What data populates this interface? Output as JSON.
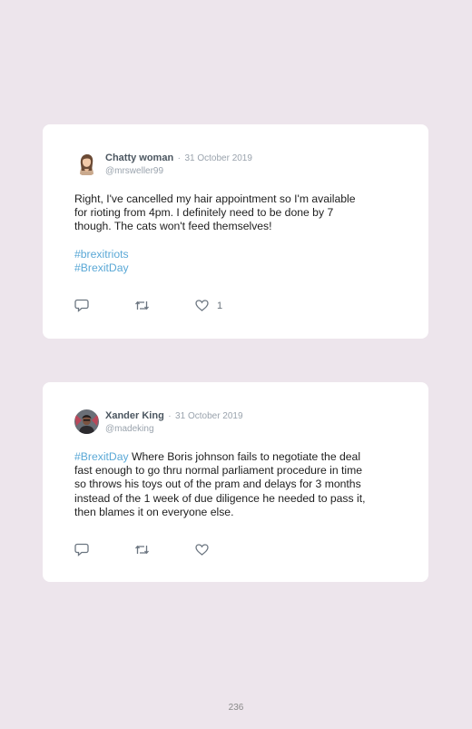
{
  "posts": [
    {
      "author": "Chatty woman",
      "separator": "·",
      "date": "31 October 2019",
      "handle": "@mrsweller99",
      "text_lines": [
        "Right, I've cancelled my hair appointment so I'm available",
        "for rioting from 4pm. I definitely need to be done by 7",
        "though. The cats won't feed themselves!"
      ],
      "hashtags": [
        "#brexitriots",
        "#BrexitDay"
      ],
      "likes": "1",
      "avatar_icon": "woman-avatar-icon"
    },
    {
      "author": "Xander King",
      "separator": "·",
      "date": "31 October 2019",
      "handle": "@madeking",
      "lead_hashtag": "#BrexitDay",
      "text_lead": " Where Boris johnson fails to negotiate the deal",
      "text_lines": [
        "fast enough to go thru normal parliament procedure in time",
        "so throws his toys out of the pram and delays for 3 months",
        "instead of the 1 week of due diligence he needed to pass it,",
        "then blames it on everyone else."
      ],
      "avatar_icon": "man-avatar-icon"
    }
  ],
  "page_number": "236",
  "colors": {
    "background": "#ede5ec",
    "card": "#ffffff",
    "hashtag": "#5aa8d6",
    "muted": "#9aa3ad"
  }
}
